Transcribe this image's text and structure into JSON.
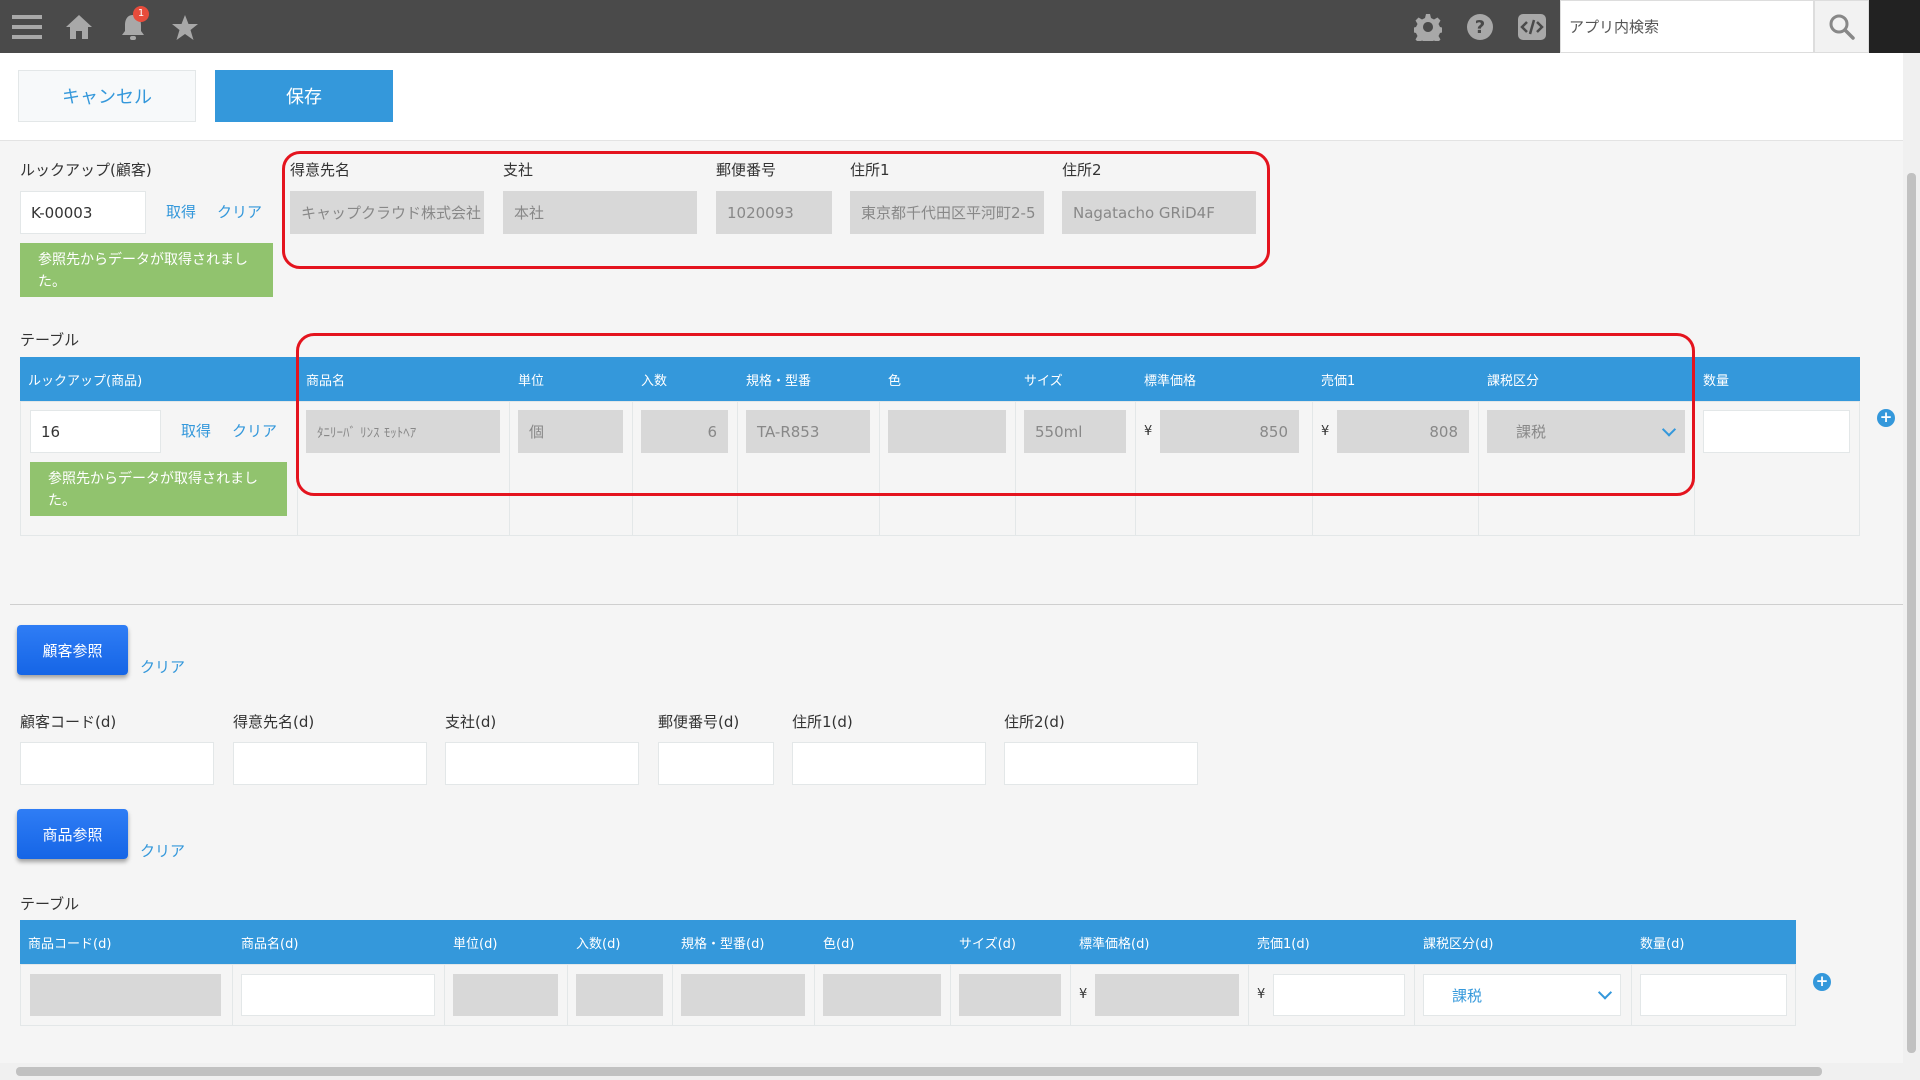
{
  "header": {
    "notification_count": "1",
    "search_placeholder": "アプリ内検索"
  },
  "toolbar": {
    "cancel_label": "キャンセル",
    "save_label": "保存"
  },
  "lookup_customer": {
    "label": "ルックアップ(顧客)",
    "value": "K-00003",
    "get_label": "取得",
    "clear_label": "クリア",
    "message": "参照先からデータが取得されました。"
  },
  "customer_fields": [
    {
      "label": "得意先名",
      "value": "キャップクラウド株式会社"
    },
    {
      "label": "支社",
      "value": "本社"
    },
    {
      "label": "郵便番号",
      "value": "1020093"
    },
    {
      "label": "住所1",
      "value": "東京都千代田区平河町2-5"
    },
    {
      "label": "住所2",
      "value": "Nagatacho GRiD4F"
    }
  ],
  "table1": {
    "title": "テーブル",
    "headers": [
      "ルックアップ(商品)",
      "商品名",
      "単位",
      "入数",
      "規格・型番",
      "色",
      "サイズ",
      "標準価格",
      "売価1",
      "課税区分",
      "数量"
    ],
    "row": {
      "lookup_value": "16",
      "get_label": "取得",
      "clear_label": "クリア",
      "message": "参照先からデータが取得されました。",
      "product_name": "ﾀﾆﾘｰﾊﾞ ﾘﾝｽ ﾓｯﾄﾍｱ",
      "unit": "個",
      "quantity_per": "6",
      "spec": "TA-R853",
      "color": "",
      "size": "550ml",
      "currency": "¥",
      "std_price": "850",
      "price1": "808",
      "tax": "課税",
      "qty": ""
    }
  },
  "customer_ref": {
    "button_label": "顧客参照",
    "clear_label": "クリア",
    "fields": [
      {
        "label": "顧客コード(d)",
        "value": ""
      },
      {
        "label": "得意先名(d)",
        "value": ""
      },
      {
        "label": "支社(d)",
        "value": ""
      },
      {
        "label": "郵便番号(d)",
        "value": ""
      },
      {
        "label": "住所1(d)",
        "value": ""
      },
      {
        "label": "住所2(d)",
        "value": ""
      }
    ]
  },
  "product_ref": {
    "button_label": "商品参照",
    "clear_label": "クリア"
  },
  "table2": {
    "title": "テーブル",
    "headers": [
      "商品コード(d)",
      "商品名(d)",
      "単位(d)",
      "入数(d)",
      "規格・型番(d)",
      "色(d)",
      "サイズ(d)",
      "標準価格(d)",
      "売価1(d)",
      "課税区分(d)",
      "数量(d)"
    ],
    "currency": "¥",
    "tax": "課税"
  }
}
